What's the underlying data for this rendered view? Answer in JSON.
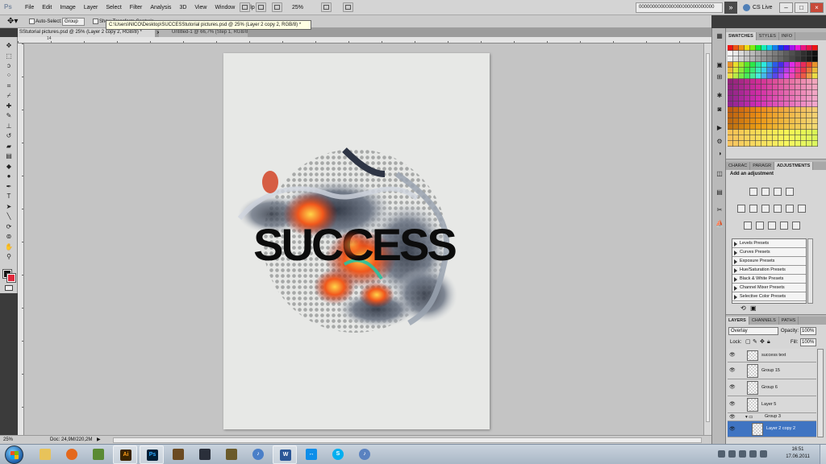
{
  "app": {
    "logo": "Ps",
    "menu": [
      "File",
      "Edit",
      "Image",
      "Layer",
      "Select",
      "Filter",
      "Analysis",
      "3D",
      "View",
      "Window",
      "Help"
    ],
    "zoom": "25%",
    "workspace_field": "0000000000000000000000000000",
    "cs_live": "CS Live"
  },
  "options": {
    "auto_select_label": "Auto-Select:",
    "auto_select_value": "Group",
    "transform_label": "Show Transform Controls"
  },
  "document": {
    "tab_active": "SStutorial pictures.psd @ 25% (Layer 2 copy 2, RGB/8) *",
    "tab_inactive": "Untitled-1 @ 66,7% (Step 1, RGB/8)",
    "path_tooltip": "C:\\Users\\NICO\\Desktop\\SUCCESStutorial pictures.psd @ 25% (Layer 2 copy 2, RGB/8) *",
    "ruler_mark": "14",
    "art_text": "SUCCESS"
  },
  "status": {
    "zoom": "25%",
    "doc_size": "Doc: 24,9M/220,2M"
  },
  "panels": {
    "swatch_tabs": [
      "SWATCHES",
      "STYLES",
      "INFO"
    ],
    "adj_tabs": [
      "CHARAC",
      "PARAGR",
      "ADJUSTMENTS"
    ],
    "adj_title": "Add an adjustment",
    "presets": [
      "Levels Presets",
      "Curves Presets",
      "Exposure Presets",
      "Hue/Saturation Presets",
      "Black & White Presets",
      "Channel Mixer Presets",
      "Selective Color Presets"
    ],
    "layer_tabs": [
      "LAYERS",
      "CHANNELS",
      "PATHS"
    ],
    "blend_mode": "Overlay",
    "opacity_label": "Opacity:",
    "opacity": "100%",
    "lock_label": "Lock:",
    "fill_label": "Fill:",
    "fill": "100%",
    "layers": [
      {
        "name": "success text",
        "type": "smart",
        "selected": false
      },
      {
        "name": "Group 15",
        "type": "layer",
        "selected": false
      },
      {
        "name": "Group 6",
        "type": "layer",
        "selected": false
      },
      {
        "name": "Layer 5",
        "type": "layer",
        "selected": false
      },
      {
        "name": "Group 3",
        "type": "group",
        "selected": false
      },
      {
        "name": "Layer 2 copy 2",
        "type": "layer",
        "selected": true
      }
    ]
  },
  "taskbar": {
    "clock_time": "16:51",
    "clock_date": "17.06.2011",
    "apps": [
      "explorer",
      "firefox",
      "minecraft",
      "illustrator",
      "photoshop",
      "chest",
      "game-a",
      "game-b",
      "itunes",
      "word",
      "teamviewer",
      "skype",
      "itunes-2"
    ]
  },
  "colors": {
    "selected_layer": "#3f74c2",
    "background_color": "#e0283c",
    "foreground_color": "#111111"
  }
}
